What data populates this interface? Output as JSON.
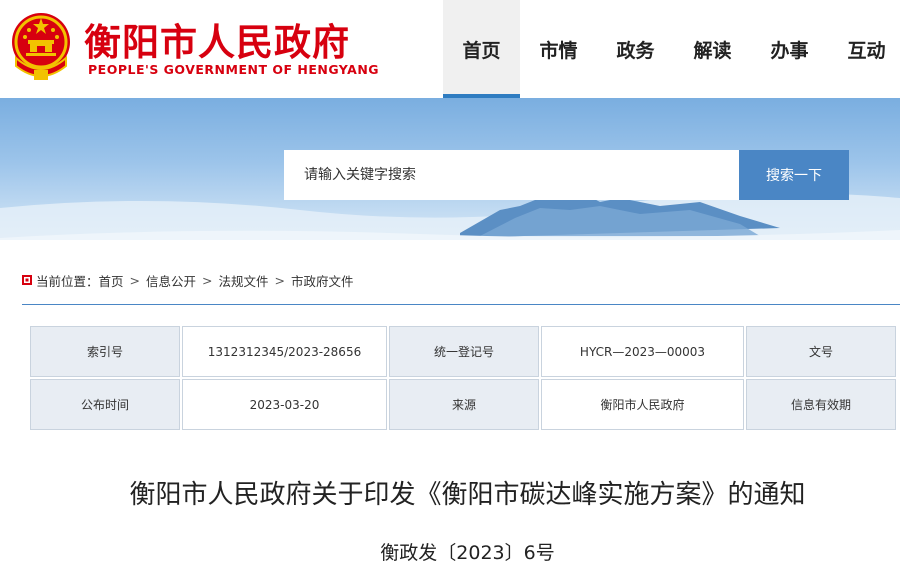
{
  "header": {
    "site_title": "衡阳市人民政府",
    "site_subtitle": "PEOPLE'S GOVERNMENT OF HENGYANG",
    "emblem_icon": "national-emblem-icon",
    "brand_color": "#d7000f"
  },
  "nav": {
    "items": [
      {
        "label": "首页",
        "active": true
      },
      {
        "label": "市情",
        "active": false
      },
      {
        "label": "政务",
        "active": false
      },
      {
        "label": "解读",
        "active": false
      },
      {
        "label": "办事",
        "active": false
      },
      {
        "label": "互动",
        "active": false
      }
    ],
    "accent_color": "#2f7cc1"
  },
  "search": {
    "placeholder": "请输入关键字搜索",
    "button_label": "搜索一下",
    "button_color": "#4a86c5"
  },
  "breadcrumb": {
    "prefix": "当前位置：",
    "items": [
      "首页",
      "信息公开",
      "法规文件",
      "市政府文件"
    ],
    "separator": ">"
  },
  "info_table": {
    "rows": [
      [
        {
          "text": "索引号",
          "type": "label"
        },
        {
          "text": "1312312345/2023-28656",
          "type": "value"
        },
        {
          "text": "统一登记号",
          "type": "label"
        },
        {
          "text": "HYCR—2023—00003",
          "type": "value"
        },
        {
          "text": "文号",
          "type": "label"
        }
      ],
      [
        {
          "text": "公布时间",
          "type": "label"
        },
        {
          "text": "2023-03-20",
          "type": "value"
        },
        {
          "text": "来源",
          "type": "label"
        },
        {
          "text": "衡阳市人民政府",
          "type": "value"
        },
        {
          "text": "信息有效期",
          "type": "label"
        }
      ]
    ]
  },
  "document": {
    "title": "衡阳市人民政府关于印发《衡阳市碳达峰实施方案》的通知",
    "number": "衡政发〔2023〕6号"
  }
}
